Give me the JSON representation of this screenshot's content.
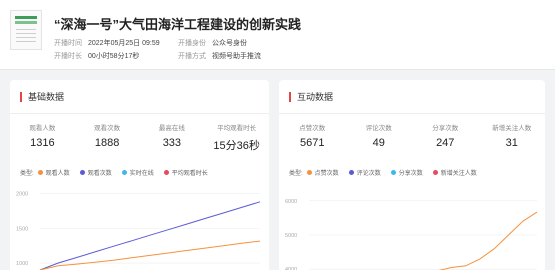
{
  "header": {
    "title": "“深海一号”大气田海洋工程建设的创新实践",
    "meta": [
      {
        "label": "开播时间",
        "value": "2022年05月25日 09:59"
      },
      {
        "label": "开播身份",
        "value": "公众号身份"
      },
      {
        "label": "开播时长",
        "value": "00小时58分17秒"
      },
      {
        "label": "开播方式",
        "value": "视频号助手推流"
      }
    ]
  },
  "basic": {
    "title": "基础数据",
    "stats": [
      {
        "label": "观看人数",
        "value": "1316"
      },
      {
        "label": "观看次数",
        "value": "1888"
      },
      {
        "label": "最高在线",
        "value": "333"
      },
      {
        "label": "平均观看时长",
        "value": "15分36秒"
      }
    ],
    "legend_lead": "类型:",
    "legend": [
      {
        "name": "观看人数",
        "color": "#f5923e"
      },
      {
        "name": "观看次数",
        "color": "#5b5bd6"
      },
      {
        "name": "实时在线",
        "color": "#3db8e8"
      },
      {
        "name": "平均观看时长",
        "color": "#e84a5f"
      }
    ],
    "y_ticks": [
      "2000",
      "1500",
      "1000"
    ]
  },
  "interact": {
    "title": "互动数据",
    "stats": [
      {
        "label": "点赞次数",
        "value": "5671"
      },
      {
        "label": "评论次数",
        "value": "49"
      },
      {
        "label": "分享次数",
        "value": "247"
      },
      {
        "label": "新增关注人数",
        "value": "31"
      }
    ],
    "legend_lead": "类型:",
    "legend": [
      {
        "name": "点赞次数",
        "color": "#f5923e"
      },
      {
        "name": "评论次数",
        "color": "#5b5bd6"
      },
      {
        "name": "分享次数",
        "color": "#3db8e8"
      },
      {
        "name": "新增关注人数",
        "color": "#e84a5f"
      }
    ],
    "y_ticks": [
      "6000",
      "5000",
      "4000"
    ]
  },
  "chart_data": [
    {
      "type": "line",
      "ylim": [
        900,
        2050
      ],
      "y_ticks": [
        2000,
        1500,
        1000
      ],
      "series": [
        {
          "name": "观看次数",
          "color": "#5b5bd6",
          "values": [
            900,
            1000,
            1080,
            1160,
            1240,
            1320,
            1400,
            1480,
            1560,
            1640,
            1720,
            1800,
            1880
          ]
        },
        {
          "name": "观看人数",
          "color": "#f5923e",
          "values": [
            900,
            960,
            985,
            1010,
            1040,
            1075,
            1110,
            1145,
            1180,
            1215,
            1250,
            1285,
            1316
          ]
        }
      ]
    },
    {
      "type": "line",
      "ylim": [
        3800,
        6200
      ],
      "y_ticks": [
        6000,
        5000,
        4000
      ],
      "series": [
        {
          "name": "点赞次数",
          "color": "#f5923e",
          "values": [
            3800,
            3800,
            3800,
            3800,
            3800,
            3800,
            3800,
            3810,
            3850,
            3950,
            4050,
            4100,
            4300,
            4600,
            5000,
            5400,
            5671
          ]
        }
      ]
    }
  ]
}
